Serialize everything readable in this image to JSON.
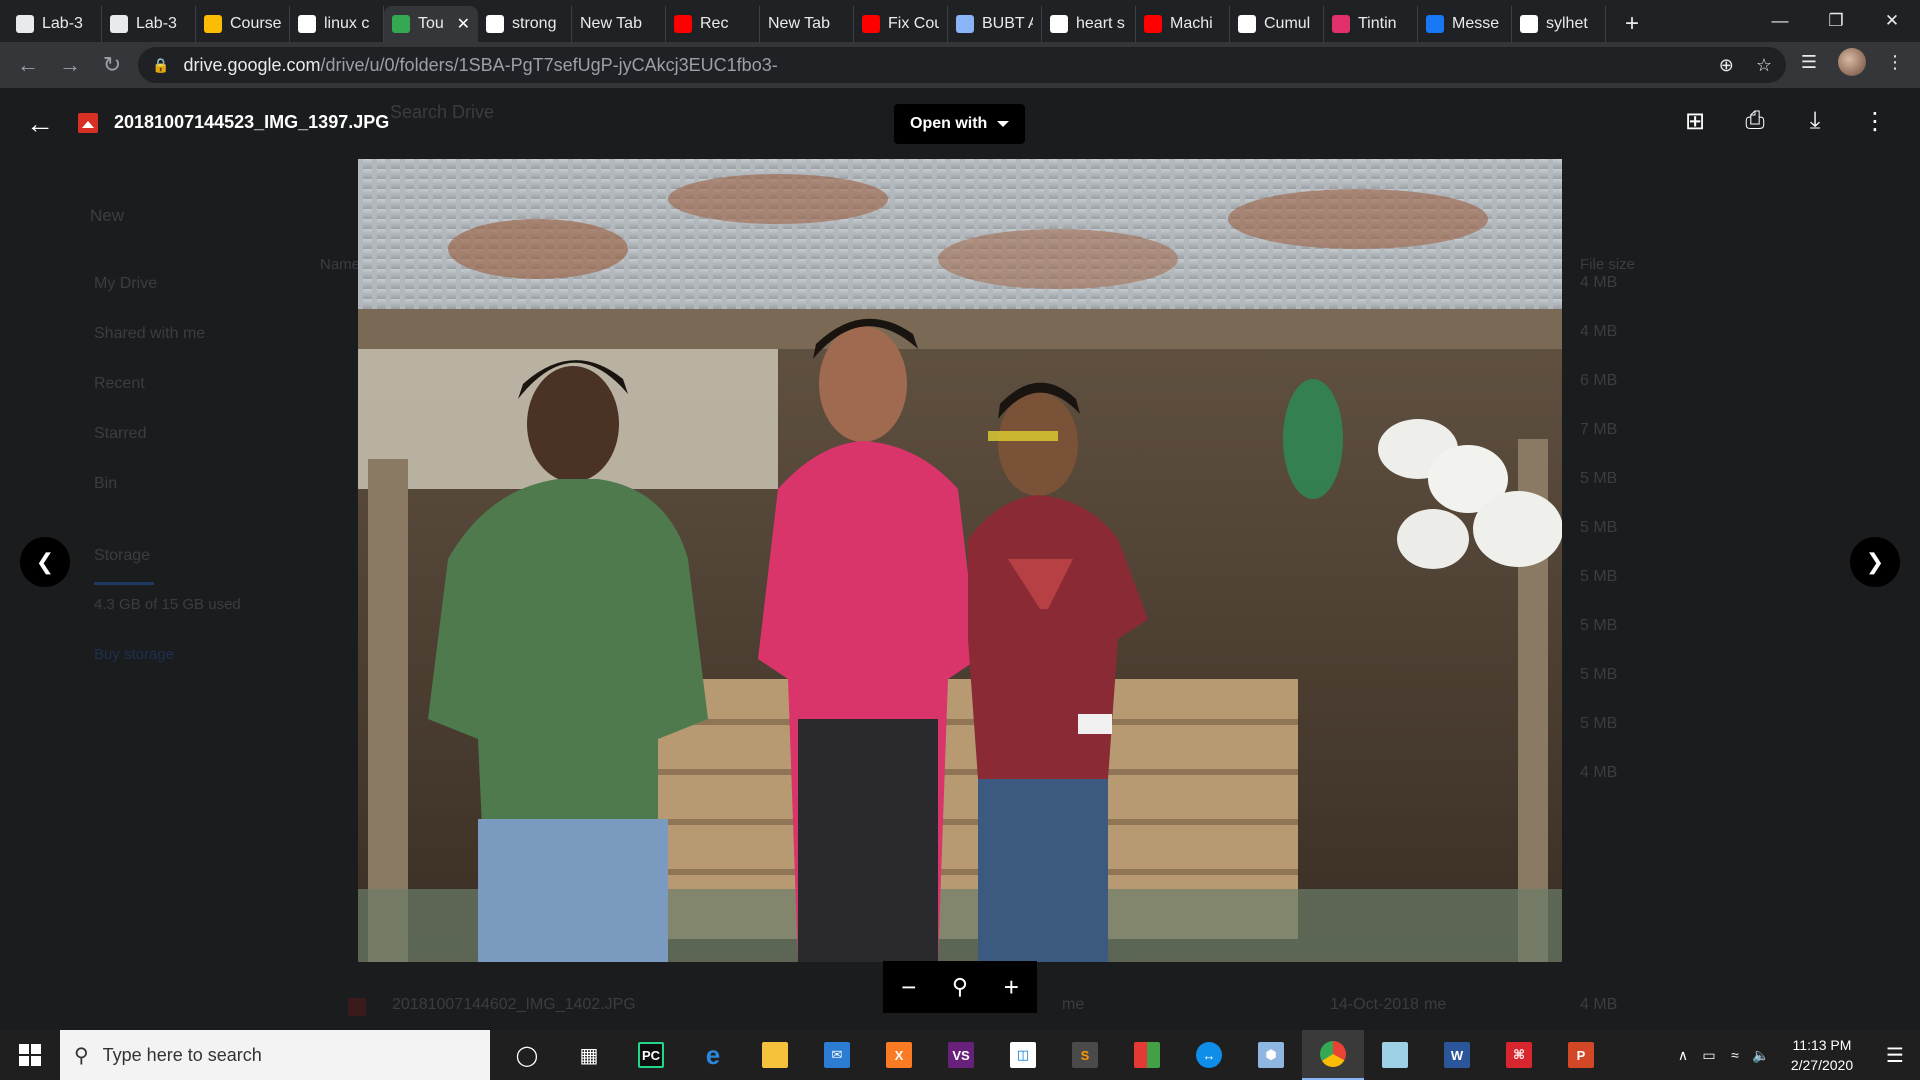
{
  "browser": {
    "tabs": [
      {
        "title": "Lab-3",
        "favicon": "classroom-icon",
        "color": "#e8eaed"
      },
      {
        "title": "Lab-3",
        "favicon": "classroom-icon",
        "color": "#e8eaed"
      },
      {
        "title": "Course",
        "favicon": "classroom-yellow-icon",
        "color": "#fbbc04"
      },
      {
        "title": "linux c",
        "favicon": "google-icon",
        "color": "#ffffff"
      },
      {
        "title": "Tou",
        "favicon": "drive-icon",
        "color": "#34a853",
        "active": true
      },
      {
        "title": "strong",
        "favicon": "google-icon",
        "color": "#ffffff"
      },
      {
        "title": "New Tab",
        "favicon": "",
        "color": ""
      },
      {
        "title": "Rec",
        "favicon": "youtube-icon",
        "color": "#ff0000"
      },
      {
        "title": "New Tab",
        "favicon": "",
        "color": ""
      },
      {
        "title": "Fix Cou",
        "favicon": "youtube-icon",
        "color": "#ff0000"
      },
      {
        "title": "BUBT A",
        "favicon": "bubt-icon",
        "color": "#8ab4f8"
      },
      {
        "title": "heart s",
        "favicon": "google-icon",
        "color": "#ffffff"
      },
      {
        "title": "Machi",
        "favicon": "youtube-icon",
        "color": "#ff0000"
      },
      {
        "title": "Cumul",
        "favicon": "bv-icon",
        "color": "#ffffff"
      },
      {
        "title": "Tintin",
        "favicon": "instagram-icon",
        "color": "#e1306c"
      },
      {
        "title": "Messe",
        "favicon": "facebook-icon",
        "color": "#1877f2"
      },
      {
        "title": "sylhet",
        "favicon": "google-icon",
        "color": "#ffffff"
      }
    ],
    "url_host": "drive.google.com",
    "url_path": "/drive/u/0/folders/1SBA-PgT7sefUgP-jyCAkcj3EUC1fbo3-"
  },
  "viewer": {
    "file_name": "20181007144523_IMG_1397.JPG",
    "open_with_label": "Open with"
  },
  "drive_background": {
    "search_placeholder": "Search Drive",
    "new_label": "New",
    "nav": [
      "My Drive",
      "Shared with me",
      "Recent",
      "Starred",
      "Bin"
    ],
    "storage_label": "Storage",
    "storage_used": "4.3 GB of 15 GB used",
    "buy_storage": "Buy storage",
    "col_name": "Name",
    "col_size": "File size",
    "sizes": [
      "4 MB",
      "4 MB",
      "6 MB",
      "7 MB",
      "5 MB",
      "5 MB",
      "5 MB",
      "5 MB",
      "5 MB",
      "5 MB",
      "4 MB"
    ],
    "last_file": "20181007144602_IMG_1402.JPG",
    "last_owner": "me",
    "last_date": "14-Oct-2018",
    "last_modified_by": "me",
    "last_size": "4 MB"
  },
  "taskbar": {
    "search_placeholder": "Type here to search",
    "time": "11:13 PM",
    "date": "2/27/2020"
  }
}
